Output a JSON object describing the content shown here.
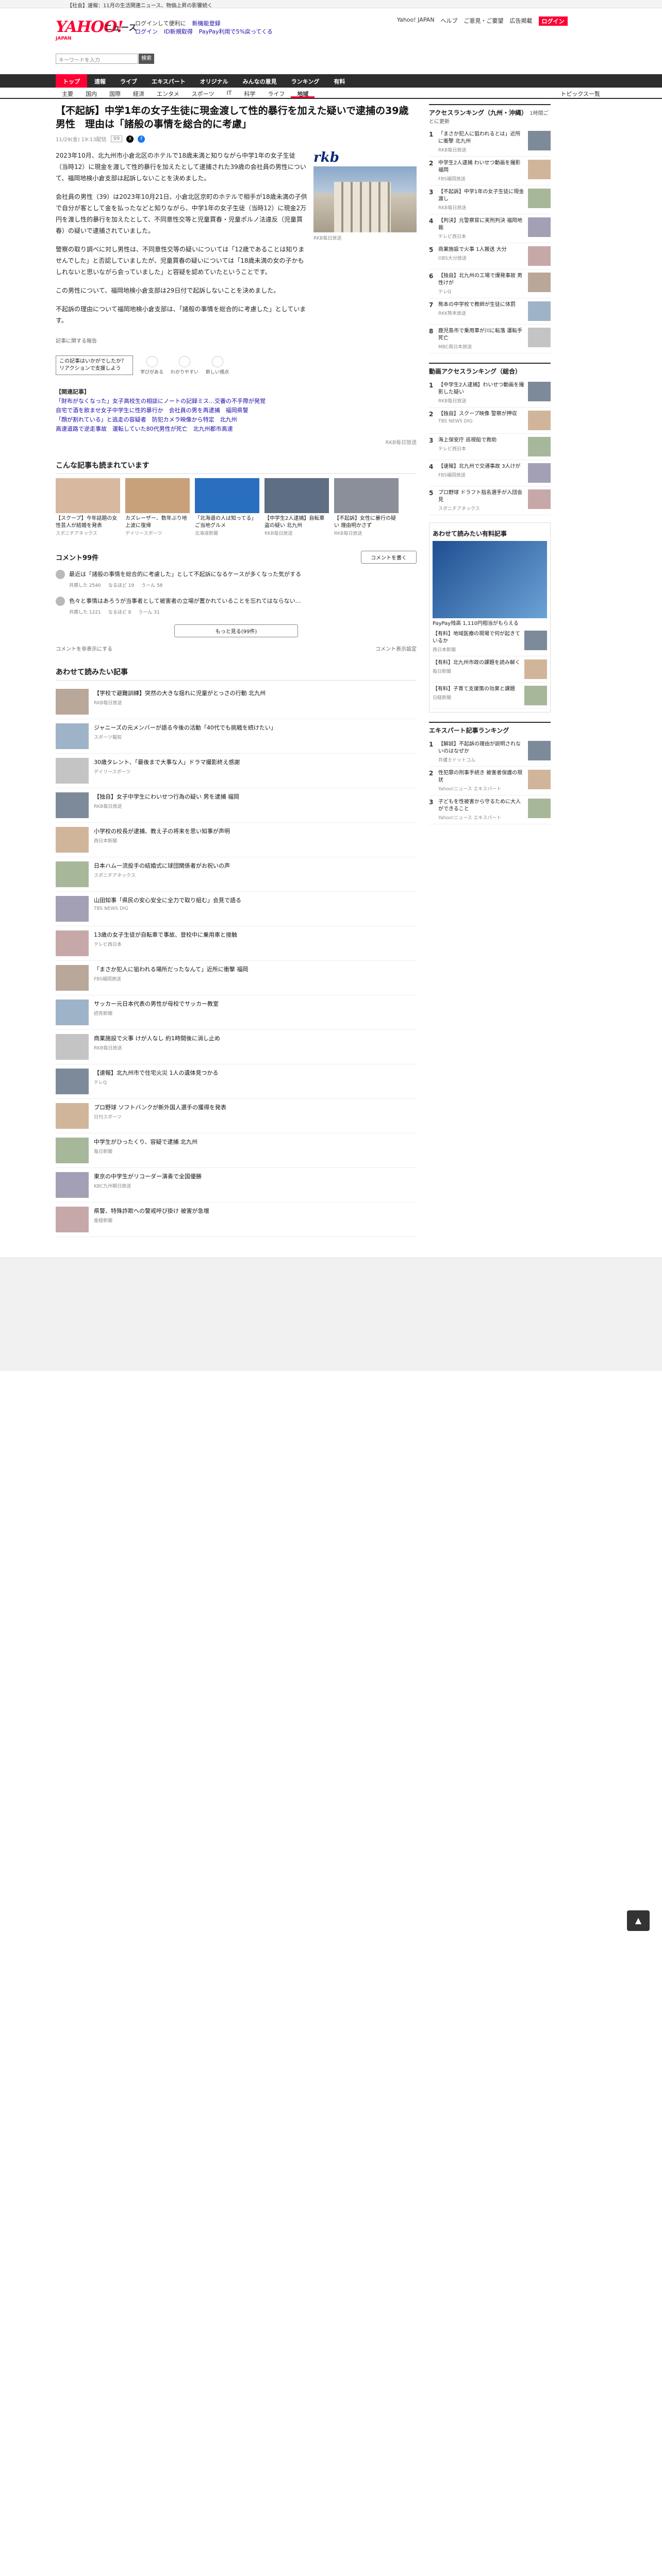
{
  "topstrip": "【社会】速報：11月の生活関連ニュース、物価上昇の影響続く",
  "header": {
    "logo": "YAHOO!",
    "logo_sub": "JAPAN",
    "service": "ニュース",
    "links_row1": [
      "ログインして便利に",
      "新機能登録"
    ],
    "links_row2": [
      "ログイン",
      "ID新規取得",
      "PayPay利用で5%戻ってくる"
    ],
    "right": [
      "Yahoo! JAPAN",
      "ヘルプ",
      "ご意見・ご要望",
      "広告掲載"
    ],
    "right_cta": "ログイン"
  },
  "search": {
    "placeholder": "キーワードを入力",
    "button": "検索"
  },
  "nav": {
    "items": [
      "トップ",
      "速報",
      "ライブ",
      "エキスパート",
      "オリジナル",
      "みんなの意見",
      "ランキング",
      "有料"
    ],
    "right": "トピックス一覧"
  },
  "subnav": {
    "items": [
      "主要",
      "国内",
      "国際",
      "経済",
      "エンタメ",
      "スポーツ",
      "IT",
      "科学",
      "ライフ",
      "地域"
    ],
    "right": "トピックス一覧"
  },
  "article": {
    "title": "【不起訴】中学1年の女子生徒に現金渡して性的暴行を加えた疑いで逮捕の39歳男性　理由は「諸般の事情を総合的に考慮」",
    "meta": "11/29(金) 19:13配信",
    "comments_badge": "99",
    "paragraphs": [
      "2023年10月、北九州市小倉北区のホテルで18歳未満と知りながら中学1年の女子生徒（当時12）に現金を渡して性的暴行を加えたとして逮捕された39歳の会社員の男性について、福岡地検小倉支部は起訴しないことを決めました。",
      "会社員の男性（39）は2023年10月21日、小倉北区京町のホテルで相手が18歳未満の子供で自分が客として金を払ったなどと知りながら、中学1年の女子生徒（当時12）に現金2万円を渡し性的暴行を加えたとして、不同意性交等と児童買春・児童ポルノ法違反（児童買春）の疑いで逮捕されていました。",
      "警察の取り調べに対し男性は、不同意性交等の疑いについては「12歳であることは知りませんでした」と否認していましたが、児童買春の疑いについては「18歳未満の女の子かもしれないと思いながら会っていました」と容疑を認めていたということです。",
      "この男性について、福岡地検小倉支部は29日付で起訴しないことを決めました。",
      "不起訴の理由について福岡地検小倉支部は、「諸般の事情を総合的に考慮した」としています。"
    ],
    "photo_cap": "RKB毎日放送",
    "label_row": "記事に関する報告",
    "reactions": [
      "学びがある",
      "わかりやすい",
      "新しい視点"
    ],
    "reaction_tip": "この記事はいかがでしたか？リアクションで支援しよう",
    "related_title": "【関連記事】",
    "related": [
      "「財布がなくなった」女子高校生の相談にノートの記録ミス…交番の不手際が発覚",
      "自宅で酒を飲ませ女子中学生に性的暴行か　会社員の男を再逮捕　福岡県警",
      "「顔が割れている」と逃走の容疑者　防犯カメラ映像から特定　北九州",
      "高速道路で逆走事故　運転していた80代男性が死亡　北九州都市高速"
    ],
    "source": "RKB毎日放送"
  },
  "also_read": {
    "title": "こんな記事も読まれています",
    "cards": [
      {
        "t": "【スクープ】今年話題の女性芸人が結婚を発表",
        "s": "スポニチアネックス"
      },
      {
        "t": "カズレーザー、数年ぶり地上波に復帰",
        "s": "デイリースポーツ"
      },
      {
        "t": "「北海道の人は知ってる」ご当地グルメ",
        "s": "北海道新聞"
      },
      {
        "t": "【中学生2人逮捕】自転車盗の疑い 北九州",
        "s": "RKB毎日放送"
      },
      {
        "t": "【不起訴】女性に暴行の疑い 理由明かさず",
        "s": "RKB毎日放送"
      }
    ]
  },
  "comments": {
    "title": "コメント99件",
    "post_button": "コメントを書く",
    "items": [
      {
        "text": "最近は「諸般の事情を総合的に考慮した」として不起訴になるケースが多くなった気がする",
        "foot": [
          "共感した 2540",
          "なるほど 19",
          "うーん 58"
        ]
      },
      {
        "text": "色々と事情はあろうが当事者として被害者の立場が置かれていることを忘れてはならない…",
        "foot": [
          "共感した 1221",
          "なるほど 8",
          "うーん 31"
        ]
      }
    ],
    "more_button": "もっと見る(99件)",
    "note_left": "コメントを非表示にする",
    "note_right": "コメント表示設定"
  },
  "recommended": {
    "title": "あわせて読みたい記事",
    "items": [
      {
        "t": "【学校で避難訓練】突然の大きな揺れに児童がとっさの行動 北九州",
        "s": "RKB毎日放送"
      },
      {
        "t": "ジャニーズの元メンバーが語る今後の活動「40代でも挑戦を続けたい」",
        "s": "スポーツ報知"
      },
      {
        "t": "30歳タレント、「最後まで大事な人」ドラマ撮影終え感謝",
        "s": "デイリースポーツ"
      },
      {
        "t": "【独自】女子中学生にわいせつ行為の疑い 男を逮捕 福岡",
        "s": "RKB毎日放送"
      },
      {
        "t": "小学校の校長が逮捕、教え子の将来を思い知事が声明",
        "s": "西日本新聞"
      },
      {
        "t": "日本ハム一流投手の結婚式に球団関係者がお祝いの声",
        "s": "スポニチアネックス"
      },
      {
        "t": "山田知事「県民の安心安全に全力で取り組む」会見で語る",
        "s": "TBS NEWS DIG"
      },
      {
        "t": "13歳の女子生徒が自転車で事故、登校中に乗用車と接触",
        "s": "テレビ西日本"
      },
      {
        "t": "「まさか犯人に狙われる場所だったなんて」近所に衝撃 福岡",
        "s": "FBS福岡放送"
      },
      {
        "t": "サッカー元日本代表の男性が母校でサッカー教室",
        "s": "読売新聞"
      },
      {
        "t": "商業施設で火事 けが人なし 約1時間後に消し止め",
        "s": "RKB毎日放送"
      },
      {
        "t": "【速報】北九州市で住宅火災 1人の遺体見つかる",
        "s": "テレQ"
      },
      {
        "t": "プロ野球 ソフトバンクが新外国人選手の獲得を発表",
        "s": "日刊スポーツ"
      },
      {
        "t": "中学生がひったくり、容疑で逮捕 北九州",
        "s": "毎日新聞"
      },
      {
        "t": "東京の中学生がリコーダー演奏で全国優勝",
        "s": "KBC九州朝日放送"
      },
      {
        "t": "県警、特殊詐欺への警戒呼び掛け 被害が急増",
        "s": "産経新聞"
      }
    ]
  },
  "sidebar": {
    "ranking_title": "アクセスランキング（九州・沖縄）",
    "ranking_sub": "1時間ごとに更新",
    "ranking": [
      {
        "t": "「まさか犯人に狙われるとは」近所に衝撃 北九州",
        "s": "RKB毎日放送"
      },
      {
        "t": "中学生2人逮捕 わいせつ動画を撮影 福岡",
        "s": "FBS福岡放送"
      },
      {
        "t": "【不起訴】中学1年の女子生徒に現金渡し",
        "s": "RKB毎日放送"
      },
      {
        "t": "【判決】元警察官に実刑判決 福岡地裁",
        "s": "テレビ西日本"
      },
      {
        "t": "商業施設で火事 1人搬送 大分",
        "s": "OBS大分放送"
      },
      {
        "t": "【独自】北九州の工場で爆発事故 男性けが",
        "s": "テレQ"
      },
      {
        "t": "熊本の中学校で教師が生徒に体罰",
        "s": "RKK熊本放送"
      },
      {
        "t": "鹿児島市で乗用車が川に転落 運転手死亡",
        "s": "MBC南日本放送"
      }
    ],
    "topics_title": "動画アクセスランキング（総合）",
    "topics": [
      {
        "t": "【中学生2人逮捕】わいせつ動画を撮影した疑い",
        "s": "RKB毎日放送"
      },
      {
        "t": "【独自】スクープ映像 警察が押収",
        "s": "TBS NEWS DIG"
      },
      {
        "t": "海上保安庁 巡視船で救助",
        "s": "テレビ西日本"
      },
      {
        "t": "【速報】北九州で交通事故 3人けが",
        "s": "FBS福岡放送"
      },
      {
        "t": "プロ野球 ドラフト指名選手が入団会見",
        "s": "スポニチアネックス"
      }
    ],
    "ad_title": "あわせて読みたい有料記事",
    "ad_text": "PayPay残高 1,110円相当がもらえる",
    "ad_items": [
      {
        "t": "【有料】地域医療の現場で何が起きているか",
        "s": "西日本新聞"
      },
      {
        "t": "【有料】北九州市政の課題を読み解く",
        "s": "毎日新聞"
      },
      {
        "t": "【有料】子育て支援策の効果と課題",
        "s": "日経新聞"
      }
    ],
    "expert_title": "エキスパート記事ランキング",
    "expert": [
      {
        "t": "【解説】不起訴の理由が説明されないのはなぜか",
        "s": "弁護士ドットコム"
      },
      {
        "t": "性犯罪の刑事手続き 被害者保護の現状",
        "s": "Yahoo!ニュース エキスパート"
      },
      {
        "t": "子どもを性被害から守るために大人ができること",
        "s": "Yahoo!ニュース エキスパート"
      }
    ]
  },
  "scroll_top": "▲"
}
